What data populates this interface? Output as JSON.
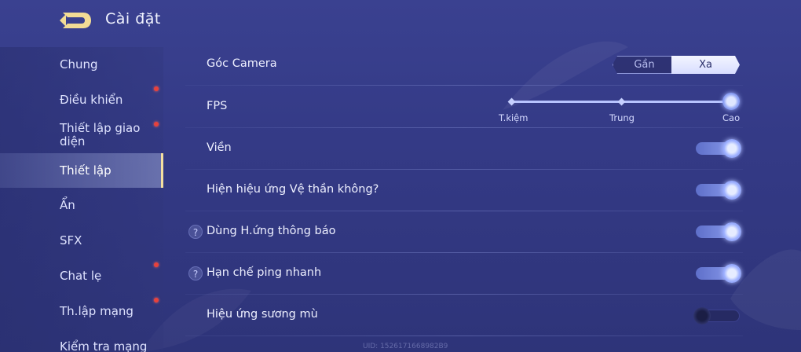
{
  "header": {
    "title": "Cài đặt"
  },
  "sidebar": {
    "items": [
      {
        "label": "Chung",
        "dot": false,
        "active": false
      },
      {
        "label": "Điều khiển",
        "dot": true,
        "active": false
      },
      {
        "label": "Thiết lập giao diện",
        "dot": true,
        "active": false
      },
      {
        "label": "Thiết lập",
        "dot": false,
        "active": true
      },
      {
        "label": "Ẩn",
        "dot": false,
        "active": false
      },
      {
        "label": "SFX",
        "dot": false,
        "active": false
      },
      {
        "label": "Chat lẹ",
        "dot": true,
        "active": false
      },
      {
        "label": "Th.lập mạng",
        "dot": true,
        "active": false
      },
      {
        "label": "Kiểm tra mạng",
        "dot": false,
        "active": false
      }
    ]
  },
  "settings": {
    "camera": {
      "label": "Góc Camera",
      "options": [
        "Gần",
        "Xa"
      ],
      "selected": "Xa"
    },
    "fps": {
      "label": "FPS",
      "levels": [
        "T.kiệm",
        "Trung",
        "Cao"
      ],
      "selected": "Cao"
    },
    "outline": {
      "label": "Viền",
      "on": true
    },
    "guardian_effect": {
      "label": "Hiện hiệu ứng Vệ thần không?",
      "on": true
    },
    "notify_effect": {
      "label": "Dùng H.ứng thông báo",
      "on": true,
      "help": "?"
    },
    "quick_ping": {
      "label": "Hạn chế ping nhanh",
      "on": true,
      "help": "?"
    },
    "fog_effect": {
      "label": "Hiệu ứng sương mù",
      "on": false
    }
  },
  "footer": {
    "uid": "UID: 1526171668982B9"
  },
  "colors": {
    "accent": "#f4dfa0",
    "notification_dot": "#e8413c",
    "toggle_on": "#8fa0f0"
  },
  "icons": {
    "back": "back-arrow-icon",
    "help": "help-circle-icon"
  }
}
